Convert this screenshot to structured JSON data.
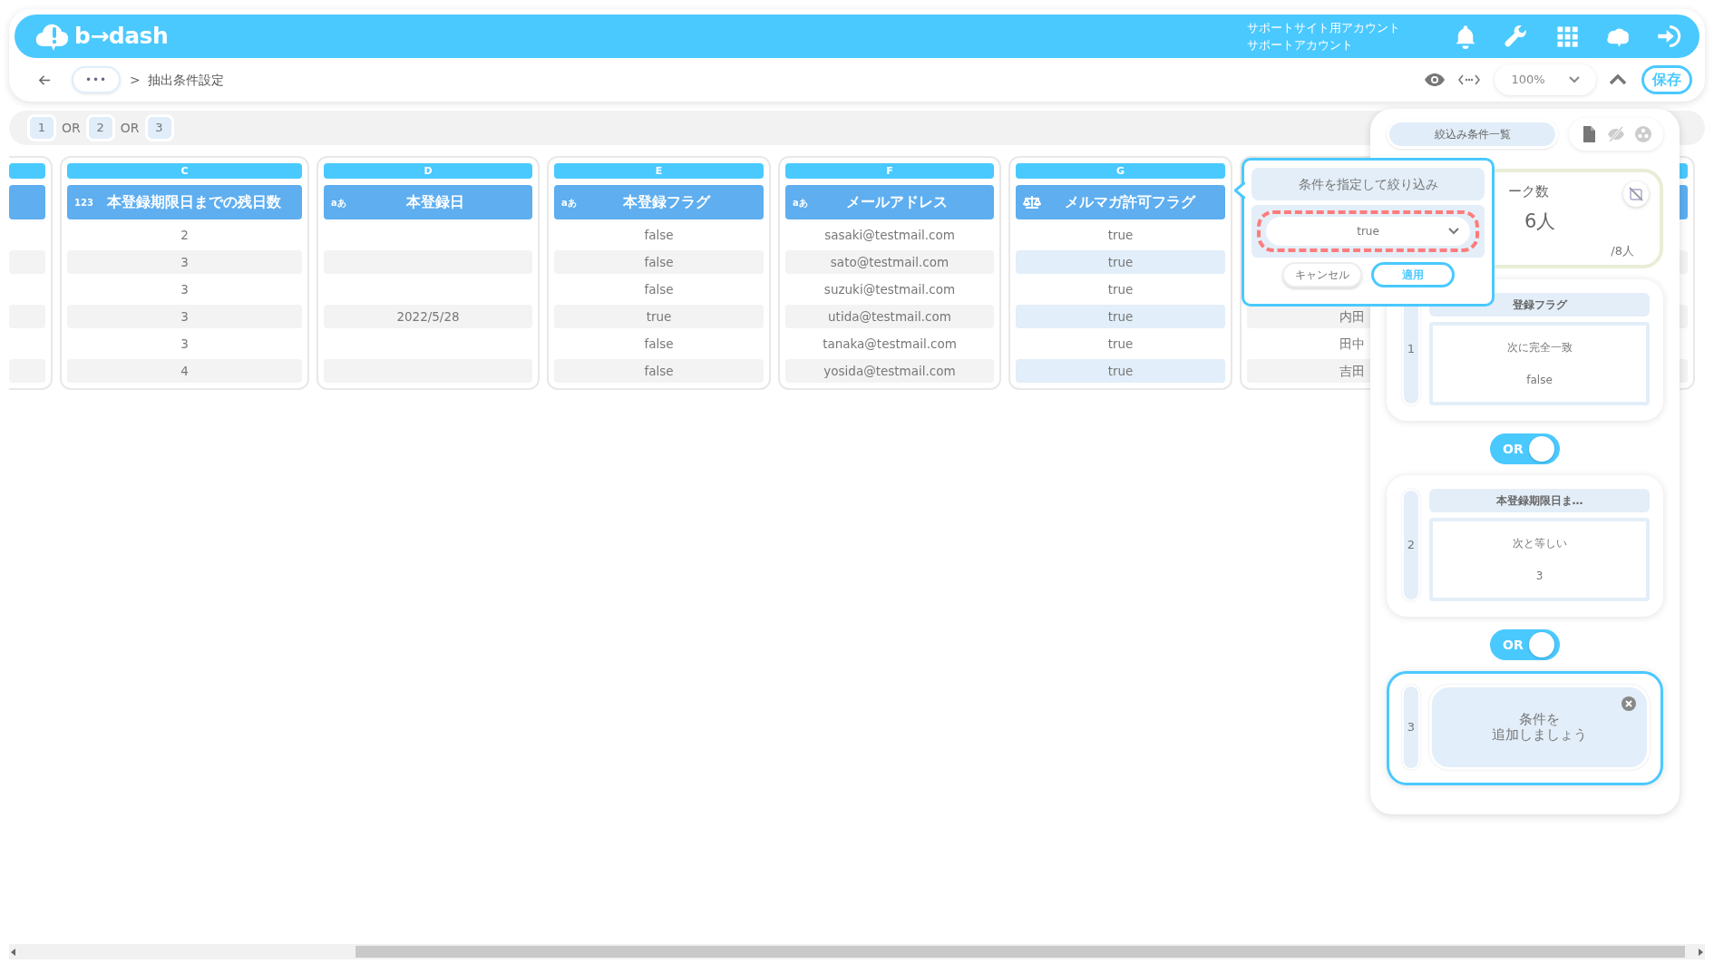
{
  "header": {
    "logo_text": "b→dash",
    "account_lines": [
      "サポートサイト用アカウント",
      "サポートアカウント"
    ]
  },
  "toolbar": {
    "breadcrumb_more": "•••",
    "breadcrumb_separator": ">",
    "breadcrumb_current": "抽出条件設定",
    "zoom": "100%",
    "save_button": "保存"
  },
  "condition_strip": [
    {
      "kind": "chip",
      "label": "1"
    },
    {
      "kind": "joiner",
      "label": "OR"
    },
    {
      "kind": "chip",
      "label": "2"
    },
    {
      "kind": "joiner",
      "label": "OR"
    },
    {
      "kind": "chip",
      "label": "3"
    }
  ],
  "columns": [
    {
      "letter": "C",
      "kind": "label",
      "type_label": "123",
      "title": "本登録期限日までの残日数",
      "selected": false,
      "cells": [
        "2",
        "3",
        "3",
        "3",
        "3",
        "4"
      ]
    },
    {
      "letter": "D",
      "kind": "label",
      "type_label": "aあ",
      "title": "本登録日",
      "selected": false,
      "cells": [
        null,
        null,
        null,
        "2022/5/28",
        null,
        null
      ]
    },
    {
      "letter": "E",
      "kind": "label",
      "type_label": "aあ",
      "title": "本登録フラグ",
      "selected": false,
      "cells": [
        "false",
        "false",
        "false",
        "true",
        "false",
        "false"
      ]
    },
    {
      "letter": "F",
      "kind": "label",
      "type_label": "aあ",
      "title": "メールアドレス",
      "selected": false,
      "cells": [
        "sasaki@testmail.com",
        "sato@testmail.com",
        "suzuki@testmail.com",
        "utida@testmail.com",
        "tanaka@testmail.com",
        "yosida@testmail.com"
      ]
    },
    {
      "letter": "G",
      "kind": "icon",
      "title": "メルマガ許可フラグ",
      "selected": true,
      "cells": [
        "true",
        "true",
        "true",
        "true",
        "true",
        "true"
      ]
    }
  ],
  "partial_column": {
    "cells": [
      null,
      null,
      null,
      "内田",
      "田中",
      "吉田"
    ]
  },
  "filter_popup": {
    "title": "条件を指定して絞り込み",
    "value": "true",
    "highlighted": true,
    "cancel": "キャンセル",
    "apply": "適用"
  },
  "panel": {
    "title": "絞込み条件一覧",
    "count_card": {
      "label": "ーク数",
      "count": "6人",
      "total": "/8人"
    },
    "conditions": [
      {
        "kind": "condition",
        "index": "1",
        "field": "登録フラグ",
        "operator": "次に完全一致",
        "value": "false",
        "selected": false
      },
      {
        "kind": "condition",
        "index": "2",
        "field": "本登録期限日ま…",
        "operator": "次と等しい",
        "value": "3",
        "selected": false
      },
      {
        "kind": "placeholder",
        "index": "3",
        "prompt_lines": [
          "条件を",
          "追加しましょう"
        ],
        "selected": true
      }
    ],
    "connectors": [
      {
        "label": "OR",
        "on": true
      },
      {
        "label": "OR",
        "on": true
      }
    ]
  }
}
